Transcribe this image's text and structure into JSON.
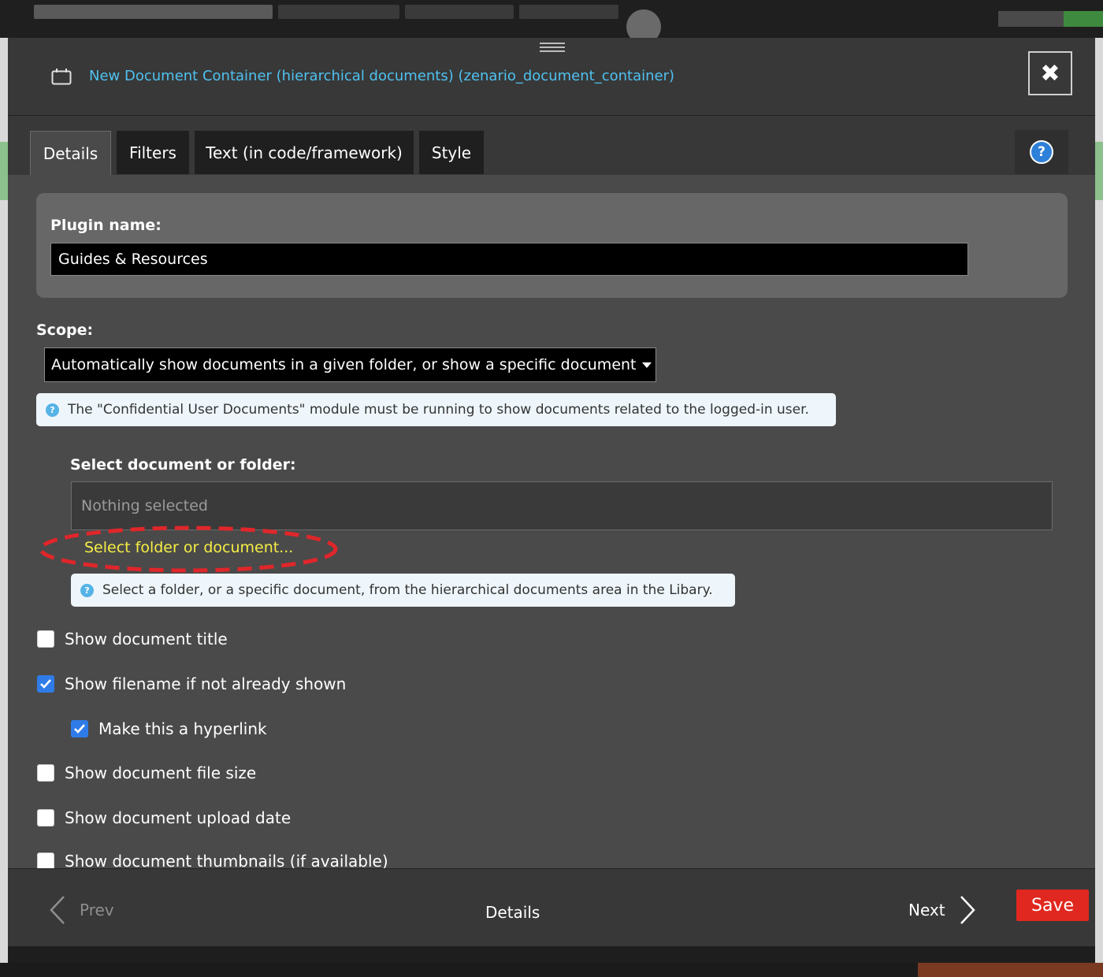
{
  "dialog": {
    "title": "New Document Container (hierarchical documents) (zenario_document_container)",
    "close_label": "✖"
  },
  "tabs": [
    {
      "label": "Details",
      "active": true
    },
    {
      "label": "Filters",
      "active": false
    },
    {
      "label": "Text (in code/framework)",
      "active": false
    },
    {
      "label": "Style",
      "active": false
    }
  ],
  "help_label": "?",
  "plugin_name": {
    "label": "Plugin name:",
    "value": "Guides & Resources"
  },
  "scope": {
    "label": "Scope:",
    "selected": "Automatically show documents in a given folder, or show a specific document",
    "note": "The \"Confidential User Documents\" module must be running to show documents related to the logged-in user."
  },
  "select_document": {
    "label": "Select document or folder:",
    "placeholder": "Nothing selected",
    "link": "Select folder or document...",
    "note": "Select a folder, or a specific document, from the hierarchical documents area in the Libary."
  },
  "options": [
    {
      "label": "Show document title",
      "checked": false
    },
    {
      "label": "Show filename if not already shown",
      "checked": true
    },
    {
      "label": "Make this a hyperlink",
      "checked": true
    },
    {
      "label": "Show document file size",
      "checked": false
    },
    {
      "label": "Show document upload date",
      "checked": false
    },
    {
      "label": "Show document thumbnails (if available)",
      "checked": false
    }
  ],
  "footer": {
    "prev": "Prev",
    "current": "Details",
    "next": "Next",
    "save": "Save"
  },
  "colors": {
    "title_link": "#4fc1f0",
    "select_link": "#f6ee44",
    "highlight": "#e0262a",
    "save": "#e02820",
    "checkbox_checked": "#2f7ce8"
  }
}
